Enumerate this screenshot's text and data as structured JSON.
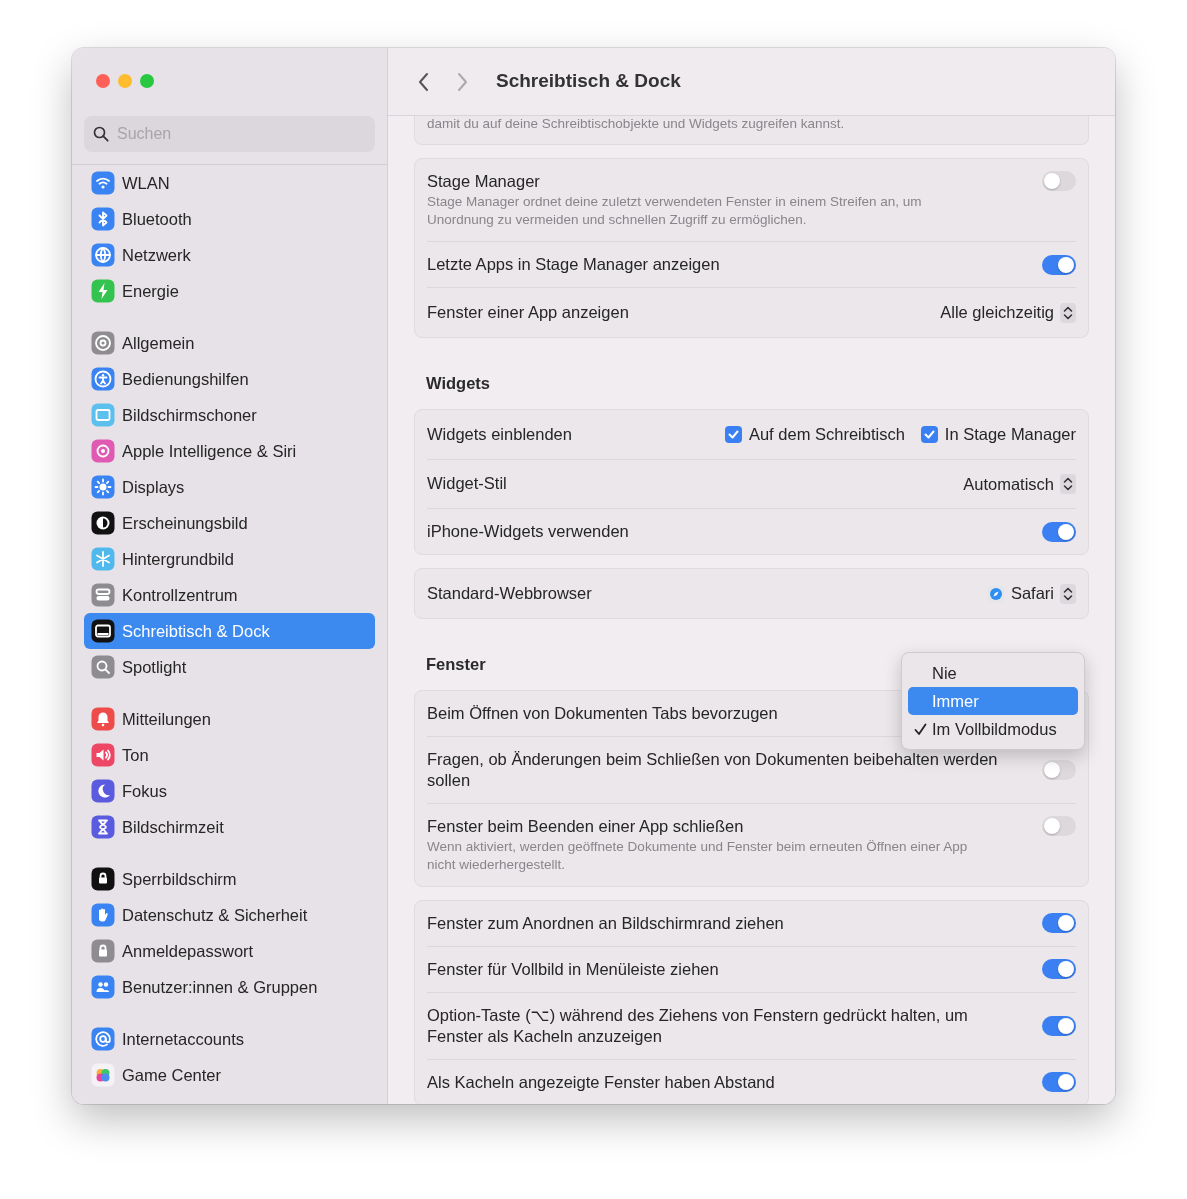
{
  "window": {
    "title": "Schreibtisch & Dock"
  },
  "sidebar": {
    "search": {
      "placeholder": "Suchen"
    },
    "groups": [
      {
        "items": [
          {
            "label": "WLAN",
            "selected": false
          },
          {
            "label": "Bluetooth",
            "selected": false
          },
          {
            "label": "Netzwerk",
            "selected": false
          },
          {
            "label": "Energie",
            "selected": false
          }
        ]
      },
      {
        "items": [
          {
            "label": "Allgemein",
            "selected": false
          },
          {
            "label": "Bedienungshilfen",
            "selected": false
          },
          {
            "label": "Bildschirmschoner",
            "selected": false
          },
          {
            "label": "Apple Intelligence & Siri",
            "selected": false
          },
          {
            "label": "Displays",
            "selected": false
          },
          {
            "label": "Erscheinungsbild",
            "selected": false
          },
          {
            "label": "Hintergrundbild",
            "selected": false
          },
          {
            "label": "Kontrollzentrum",
            "selected": false
          },
          {
            "label": "Schreibtisch & Dock",
            "selected": true
          },
          {
            "label": "Spotlight",
            "selected": false
          }
        ]
      },
      {
        "items": [
          {
            "label": "Mitteilungen",
            "selected": false
          },
          {
            "label": "Ton",
            "selected": false
          },
          {
            "label": "Fokus",
            "selected": false
          },
          {
            "label": "Bildschirmzeit",
            "selected": false
          }
        ]
      },
      {
        "items": [
          {
            "label": "Sperrbildschirm",
            "selected": false
          },
          {
            "label": "Datenschutz & Sicherheit",
            "selected": false
          },
          {
            "label": "Anmeldepasswort",
            "selected": false
          },
          {
            "label": "Benutzer:innen & Gruppen",
            "selected": false
          }
        ]
      },
      {
        "items": [
          {
            "label": "Internetaccounts",
            "selected": false
          },
          {
            "label": "Game Center",
            "selected": false
          }
        ]
      }
    ]
  },
  "content": [
    {
      "kind": "card",
      "rows": [
        {
          "kind": "note",
          "text": "damit du auf deine Schreibtischobjekte und Widgets zugreifen kannst."
        }
      ]
    },
    {
      "kind": "card",
      "rows": [
        {
          "kind": "toggle",
          "label": "Stage Manager",
          "description": "Stage Manager ordnet deine zuletzt verwendeten Fenster in einem Streifen an, um Unordnung zu vermeiden und schnellen Zugriff zu ermöglichen.",
          "on": false
        },
        {
          "kind": "toggle",
          "label": "Letzte Apps in Stage Manager anzeigen",
          "on": true
        },
        {
          "kind": "popup",
          "label": "Fenster einer App anzeigen",
          "value": "Alle gleichzeitig"
        }
      ]
    },
    {
      "kind": "heading",
      "text": "Widgets"
    },
    {
      "kind": "card",
      "rows": [
        {
          "kind": "checkboxes",
          "label": "Widgets einblenden",
          "options": [
            {
              "label": "Auf dem Schreibtisch",
              "checked": true
            },
            {
              "label": "In Stage Manager",
              "checked": true
            }
          ]
        },
        {
          "kind": "popup",
          "label": "Widget-Stil",
          "value": "Automatisch"
        },
        {
          "kind": "toggle",
          "label": "iPhone-Widgets verwenden",
          "on": true
        }
      ]
    },
    {
      "kind": "card",
      "rows": [
        {
          "kind": "popup",
          "label": "Standard-Webbrowser",
          "value": "Safari",
          "app_icon": true
        }
      ]
    },
    {
      "kind": "heading",
      "text": "Fenster"
    },
    {
      "kind": "card",
      "rows": [
        {
          "kind": "popup",
          "label": "Beim Öffnen von Dokumenten Tabs bevorzugen"
        },
        {
          "kind": "toggle",
          "label": "Fragen, ob Änderungen beim Schließen von Dokumenten beibehalten werden sollen",
          "on": false
        },
        {
          "kind": "toggle",
          "label": "Fenster beim Beenden einer App schließen",
          "description": "Wenn aktiviert, werden geöffnete Dokumente und Fenster beim erneuten Öffnen einer App nicht wiederhergestellt.",
          "on": false
        }
      ]
    },
    {
      "kind": "card",
      "rows": [
        {
          "kind": "toggle",
          "label": "Fenster zum Anordnen an Bildschirmrand ziehen",
          "on": true
        },
        {
          "kind": "toggle",
          "label": "Fenster für Vollbild in Menüleiste ziehen",
          "on": true
        },
        {
          "kind": "toggle",
          "label": "Option-Taste (⌥) während des Ziehens von Fenstern gedrückt halten, um Fenster als Kacheln anzuzeigen",
          "on": true
        },
        {
          "kind": "toggle",
          "label": "Als Kacheln angezeigte Fenster haben Abstand",
          "on": true
        }
      ]
    }
  ],
  "popup_menu": {
    "items": [
      {
        "label": "Nie",
        "highlighted": false,
        "checked": false
      },
      {
        "label": "Immer",
        "highlighted": true,
        "checked": false
      },
      {
        "label": "Im Vollbildmodus",
        "highlighted": false,
        "checked": true
      }
    ]
  }
}
